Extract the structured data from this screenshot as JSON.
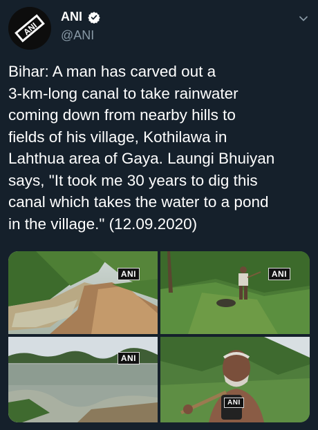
{
  "account": {
    "display_name": "ANI",
    "handle": "@ANI",
    "avatar_text": "ANI",
    "verified_icon": "verified-badge-icon"
  },
  "tweet": {
    "text": "Bihar: A man has carved out a\n3-km-long canal to take rainwater\ncoming down from nearby hills to\nfields of his village, Kothilawa in\nLahthua area of Gaya. Laungi Bhuiyan\nsays, \"It took me 30 years to dig this\ncanal which takes the water to a pond\nin the village.\" (12.09.2020)"
  },
  "media": {
    "watermark": "ANI",
    "photos": [
      {
        "watermark": "ANI"
      },
      {
        "watermark": "ANI"
      },
      {
        "watermark": "ANI"
      },
      {
        "watermark": "ANI"
      }
    ]
  },
  "colors": {
    "background": "#15202b",
    "secondary_text": "#8899a6",
    "verified": "#ffffff"
  }
}
